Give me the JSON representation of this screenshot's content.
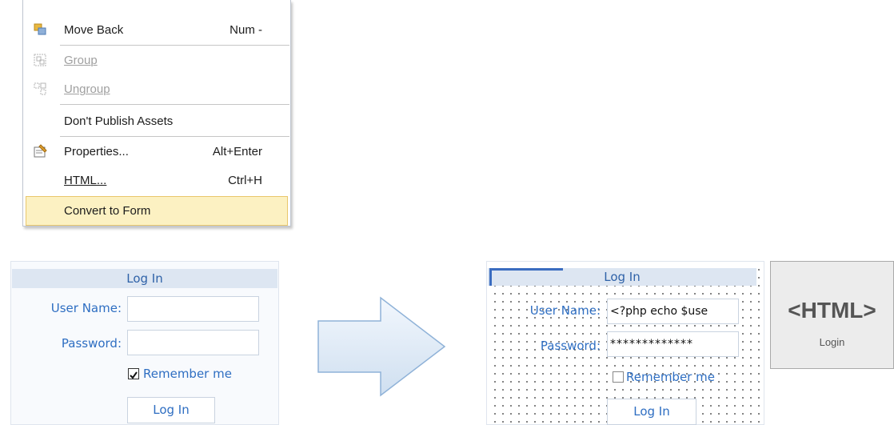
{
  "context_menu": {
    "items": [
      {
        "label": "Move Back",
        "shortcut": "Num -",
        "enabled": true
      },
      {
        "label": "Group",
        "shortcut": "",
        "enabled": false
      },
      {
        "label": "Ungroup",
        "shortcut": "",
        "enabled": false
      },
      {
        "label": "Don't Publish Assets",
        "shortcut": "",
        "enabled": true
      },
      {
        "label": "Properties...",
        "shortcut": "Alt+Enter",
        "enabled": true
      },
      {
        "label": "HTML...",
        "shortcut": "Ctrl+H",
        "enabled": true
      },
      {
        "label": "Convert to Form",
        "shortcut": "",
        "enabled": true,
        "highlighted": true
      }
    ]
  },
  "login_before": {
    "title": "Log In",
    "username_label": "User Name:",
    "username_value": "",
    "password_label": "Password:",
    "password_value": "",
    "remember_label": "Remember me",
    "remember_checked": true,
    "button_label": "Log In"
  },
  "login_after": {
    "title": "Log In",
    "username_label": "User Name:",
    "username_value": "<?php echo $use",
    "password_label": "Password:",
    "password_value": "*************",
    "remember_label": "Remember me",
    "remember_checked": false,
    "button_label": "Log In"
  },
  "html_object": {
    "tag_text": "<HTML>",
    "caption": "Login"
  },
  "colors": {
    "accent_blue": "#2e6ec2",
    "title_bar": "#dde6f2",
    "menu_highlight": "#fcf1c2",
    "arrow_fill": "#dde9f6",
    "arrow_stroke": "#8fb2d8"
  }
}
